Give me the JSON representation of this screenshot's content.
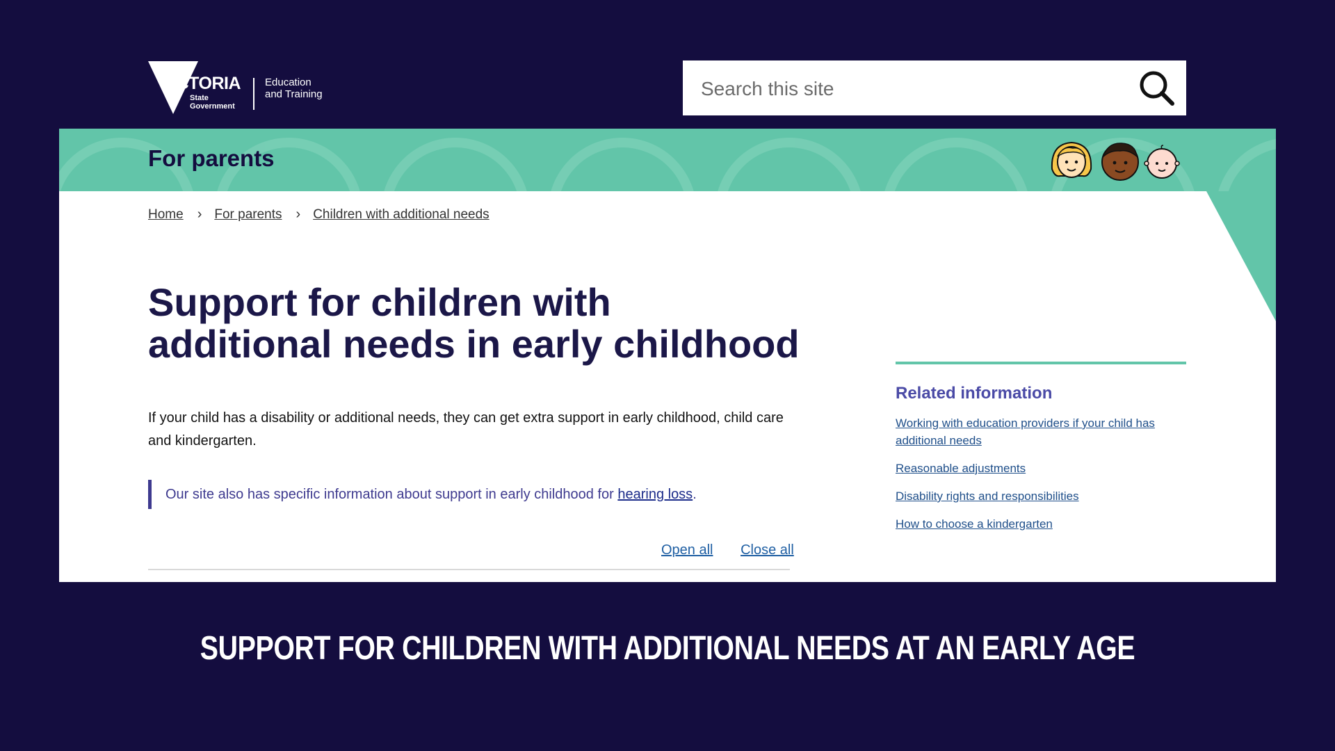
{
  "header": {
    "logo": {
      "wordmark": "VICTORIA",
      "sub_line1": "State",
      "sub_line2": "Government",
      "department_line1": "Education",
      "department_line2": "and Training"
    },
    "search": {
      "placeholder": "Search this site",
      "icon": "search-icon"
    }
  },
  "banner": {
    "section_title": "For parents",
    "background_color": "#62c5a9",
    "icons": [
      "girl-face-icon",
      "boy-face-icon",
      "baby-face-icon"
    ]
  },
  "breadcrumb": [
    {
      "label": "Home"
    },
    {
      "label": "For parents"
    },
    {
      "label": "Children with additional needs"
    }
  ],
  "main": {
    "title_line1": "Support for children with",
    "title_line2": "additional needs in early childhood",
    "intro": "If your child has a disability or additional needs, they can get extra support in early childhood, child care and kindergarten.",
    "callout": {
      "text": "Our site also has specific information about support in early childhood for ",
      "link": "hearing loss",
      "suffix": "."
    },
    "accordion": {
      "open_all": "Open all",
      "close_all": "Close all"
    }
  },
  "related": {
    "heading": "Related information",
    "links": [
      "Working with education providers if your child has additional needs",
      "Reasonable adjustments",
      "Disability rights and responsibilities",
      "How to choose a kindergarten"
    ]
  },
  "caption": "SUPPORT FOR CHILDREN WITH ADDITIONAL NEEDS AT AN EARLY AGE",
  "colors": {
    "page_background": "#140d3f",
    "accent_teal": "#62c5a9",
    "heading_navy": "#1b1748",
    "link_blue": "#1f4f8a"
  }
}
